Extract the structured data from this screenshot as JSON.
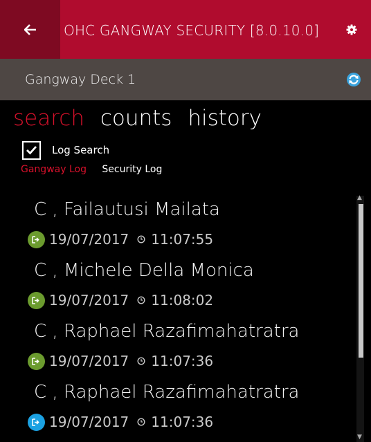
{
  "header": {
    "title": "OHC GANGWAY SECURITY [8.0.10.0]",
    "back_icon": "arrow-left-icon",
    "settings_icon": "gear-icon",
    "color": "#b00c2e"
  },
  "subheader": {
    "location": "Gangway Deck 1",
    "refresh_icon": "refresh-icon"
  },
  "tabs": [
    {
      "label": "search",
      "active": true
    },
    {
      "label": "counts",
      "active": false
    },
    {
      "label": "history",
      "active": false
    }
  ],
  "log_search": {
    "label": "Log Search",
    "checked": true
  },
  "log_tabs": [
    {
      "label": "Gangway Log",
      "active": true
    },
    {
      "label": "Security Log",
      "active": false
    }
  ],
  "entries": [
    {
      "name": "C , Failautusi Mailata",
      "date": "19/07/2017",
      "time": "11:07:55",
      "badge_color": "#6b9b2e"
    },
    {
      "name": "C , Michele Della Monica",
      "date": "19/07/2017",
      "time": "11:08:02",
      "badge_color": "#6b9b2e"
    },
    {
      "name": "C , Raphael Razafimahatratra",
      "date": "19/07/2017",
      "time": "11:07:36",
      "badge_color": "#6b9b2e"
    },
    {
      "name": "C , Raphael Razafimahatratra",
      "date": "19/07/2017",
      "time": "11:07:36",
      "badge_color": "#1ba1e2"
    }
  ]
}
